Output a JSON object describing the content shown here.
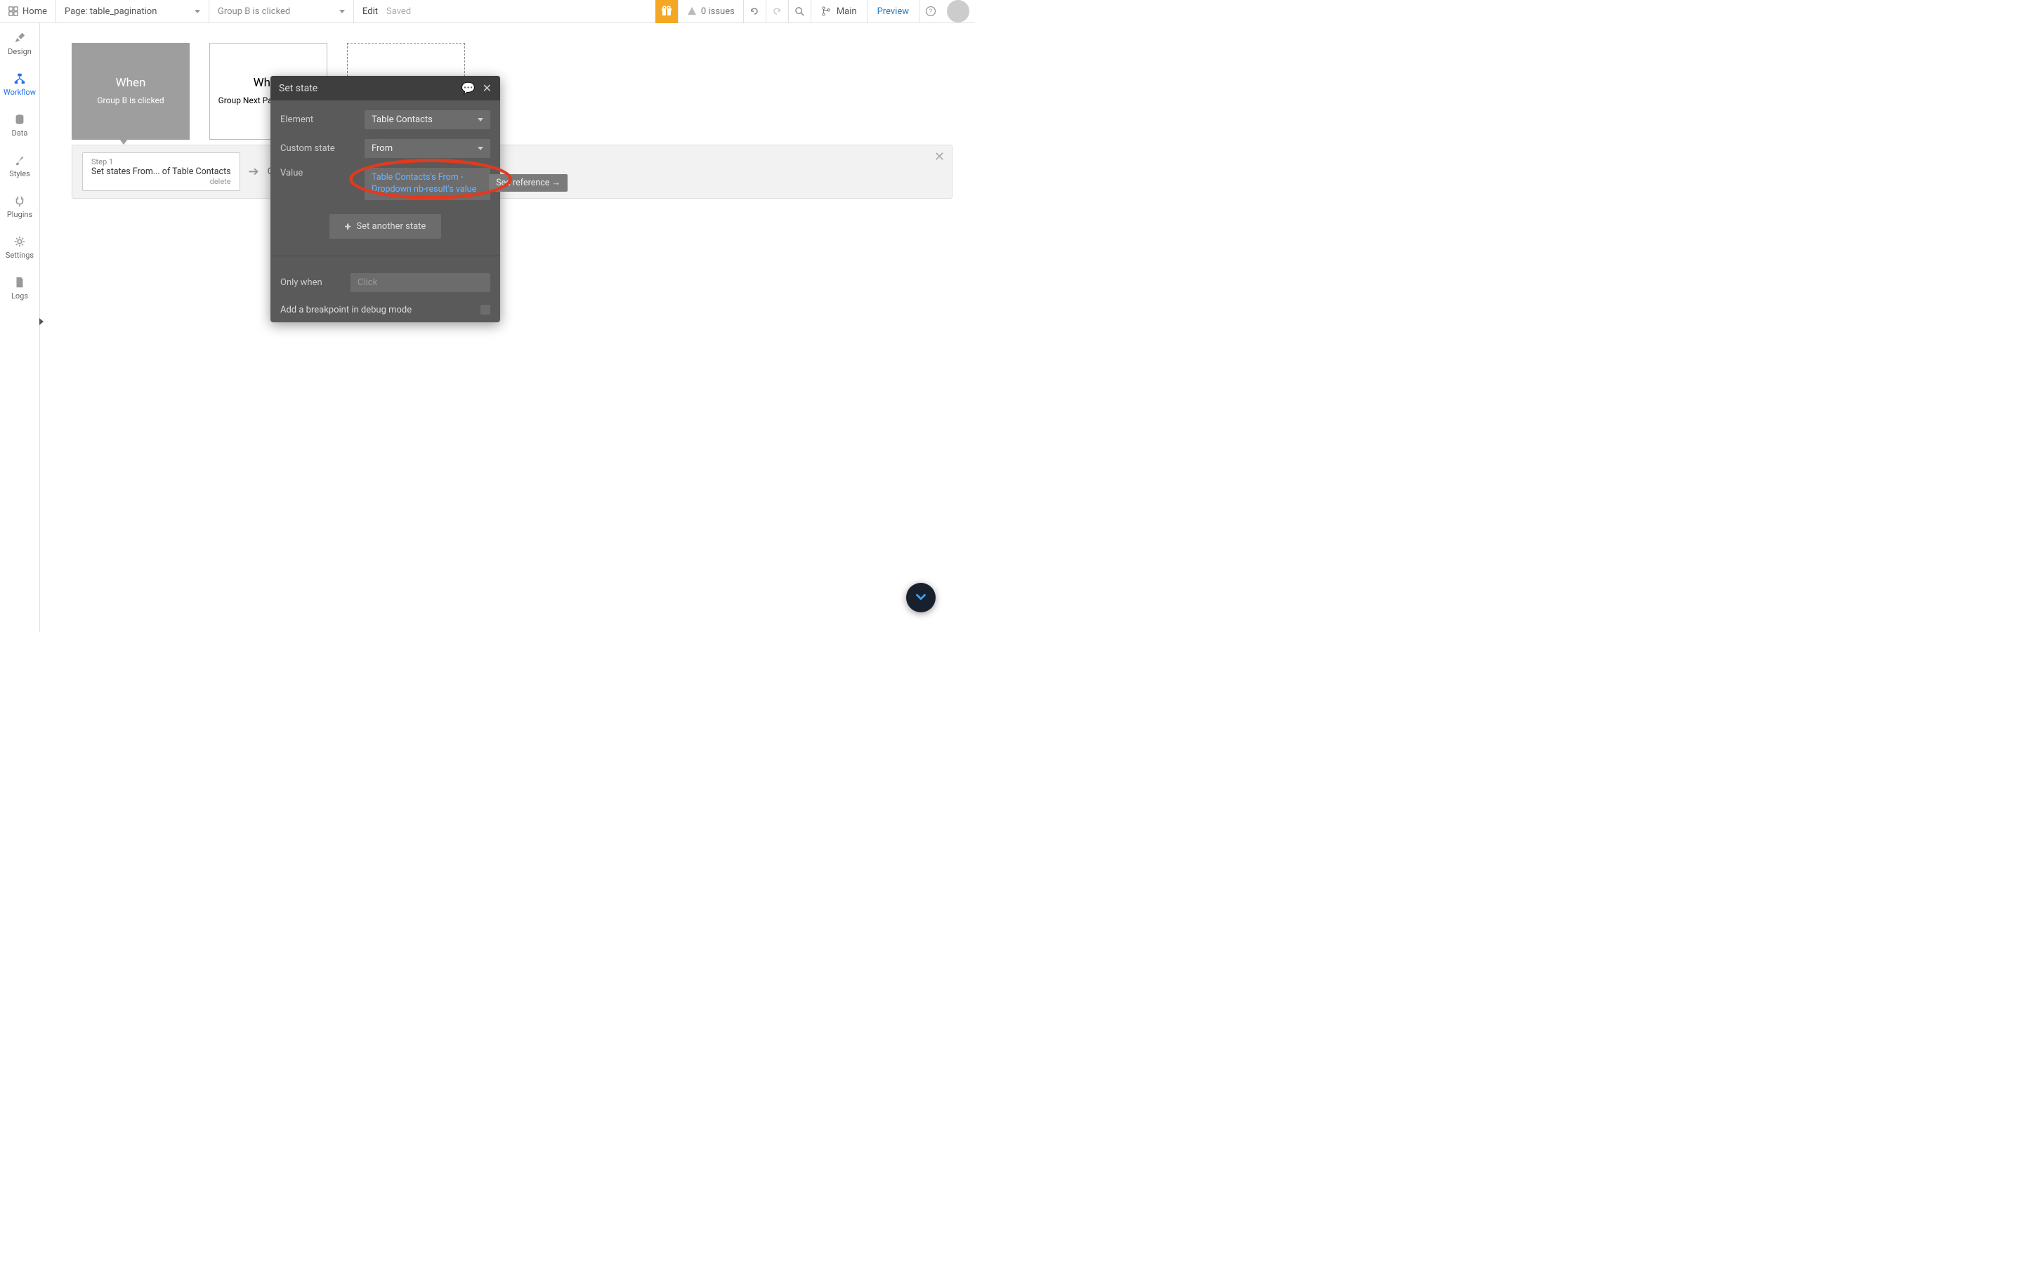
{
  "topbar": {
    "home": "Home",
    "page_prefix": "Page: table_pagination",
    "event_selected": "Group B is clicked",
    "edit": "Edit",
    "saved": "Saved",
    "issues": "0 issues",
    "main": "Main",
    "preview": "Preview"
  },
  "sidebar": {
    "items": [
      {
        "label": "Design"
      },
      {
        "label": "Workflow"
      },
      {
        "label": "Data"
      },
      {
        "label": "Styles"
      },
      {
        "label": "Plugins"
      },
      {
        "label": "Settings"
      },
      {
        "label": "Logs"
      }
    ]
  },
  "events": {
    "card1_when": "When",
    "card1_desc": "Group B is clicked",
    "card2_when": "When",
    "card2_desc": "Group Next Page is clicked"
  },
  "steps": {
    "step1_num": "Step 1",
    "step1_txt": "Set states From... of Table Contacts",
    "step1_del": "delete",
    "step2_txt": "Cli"
  },
  "panel": {
    "title": "Set state",
    "element_label": "Element",
    "element_value": "Table Contacts",
    "custom_state_label": "Custom state",
    "custom_state_value": "From",
    "value_label": "Value",
    "value_expr": "Table Contacts's From - Dropdown nb-result's value",
    "see_reference": "See reference →",
    "set_another": "Set another state",
    "only_when_label": "Only when",
    "only_when_placeholder": "Click",
    "breakpoint_label": "Add a breakpoint in debug mode"
  }
}
